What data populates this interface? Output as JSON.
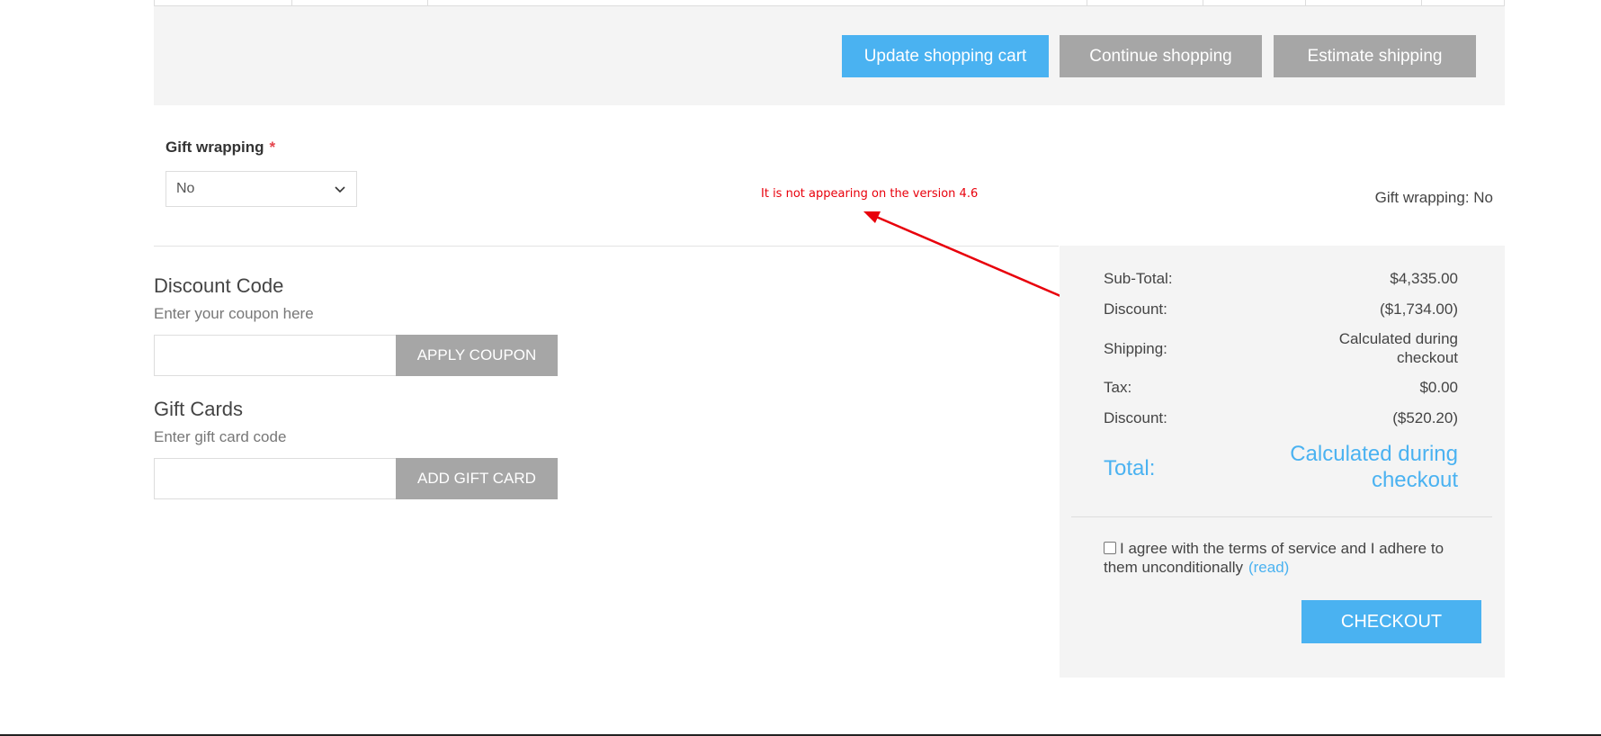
{
  "cart_actions": {
    "update_label": "Update shopping cart",
    "continue_label": "Continue shopping",
    "estimate_label": "Estimate shipping"
  },
  "gift_wrapping": {
    "label": "Gift wrapping",
    "required_mark": "*",
    "selected": "No",
    "summary": "Gift wrapping: No"
  },
  "annotation": {
    "text": "It is not appearing on the version 4.6",
    "color": "#e8000b"
  },
  "discount": {
    "title": "Discount Code",
    "hint": "Enter your coupon here",
    "input_value": "",
    "button_label": "APPLY COUPON"
  },
  "gift_cards": {
    "title": "Gift Cards",
    "hint": "Enter gift card code",
    "input_value": "",
    "button_label": "ADD GIFT CARD"
  },
  "totals": {
    "subtotal_label": "Sub-Total:",
    "subtotal_value": "$4,335.00",
    "discount_label": "Discount:",
    "discount_value": "($1,734.00)",
    "shipping_label": "Shipping:",
    "shipping_value_line1": "Calculated during",
    "shipping_value_line2": "checkout",
    "tax_label": "Tax:",
    "tax_value": "$0.00",
    "discount2_label": "Discount:",
    "discount2_value": "($520.20)",
    "total_label": "Total:",
    "total_value_line1": "Calculated during",
    "total_value_line2": "checkout"
  },
  "terms": {
    "text": "I agree with the terms of service and I adhere to them unconditionally",
    "read_link": "(read)",
    "checked": false
  },
  "checkout": {
    "button_label": "CHECKOUT"
  },
  "colors": {
    "accent": "#4ab2f1",
    "secondary_button": "#a6a6a6",
    "panel_bg": "#f4f4f4",
    "annotation": "#e8000b"
  }
}
